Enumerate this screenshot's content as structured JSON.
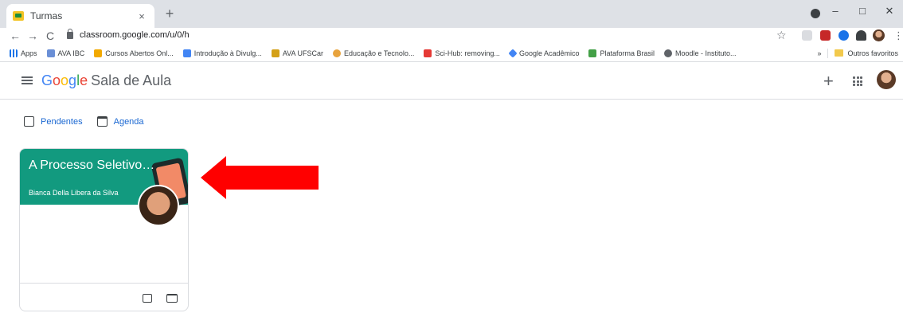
{
  "browser": {
    "tab_title": "Turmas",
    "tab_close": "×",
    "new_tab": "+",
    "url": "classroom.google.com/u/0/h",
    "window_controls": [
      "–",
      "□",
      "✕"
    ],
    "nav": [
      "←",
      "→",
      "C"
    ],
    "star": "☆"
  },
  "bookmarks": {
    "items": [
      {
        "label": "Apps",
        "color": "#1a73e8"
      },
      {
        "label": "AVA IBC",
        "color": "#6a8fd6"
      },
      {
        "label": "Cursos Abertos Onl...",
        "color": "#f2a900"
      },
      {
        "label": "Introdução à Divulg...",
        "color": "#4285f4"
      },
      {
        "label": "AVA UFSCar",
        "color": "#d4a017"
      },
      {
        "label": "Educação e Tecnolo...",
        "color": "#e8a33d"
      },
      {
        "label": "Sci-Hub: removing...",
        "color": "#e53935"
      },
      {
        "label": "Google Acadêmico",
        "color": "#4285f4"
      },
      {
        "label": "Plataforma Brasil",
        "color": "#43a047"
      },
      {
        "label": "Moodle - Instituto...",
        "color": "#5f6368"
      }
    ],
    "more": "»",
    "other_label": "Outros favoritos"
  },
  "app": {
    "logo": [
      "G",
      "o",
      "o",
      "g",
      "l",
      "e"
    ],
    "product": "Sala de Aula",
    "plus": "+"
  },
  "filters": {
    "pending_label": "Pendentes",
    "agenda_label": "Agenda"
  },
  "course": {
    "title": "A Processo Seletivo ...",
    "teacher": "Bianca Della Libera da Silva"
  },
  "colors": {
    "card_header": "#129a7f",
    "arrow": "#ff0000",
    "link": "#1967d2"
  }
}
